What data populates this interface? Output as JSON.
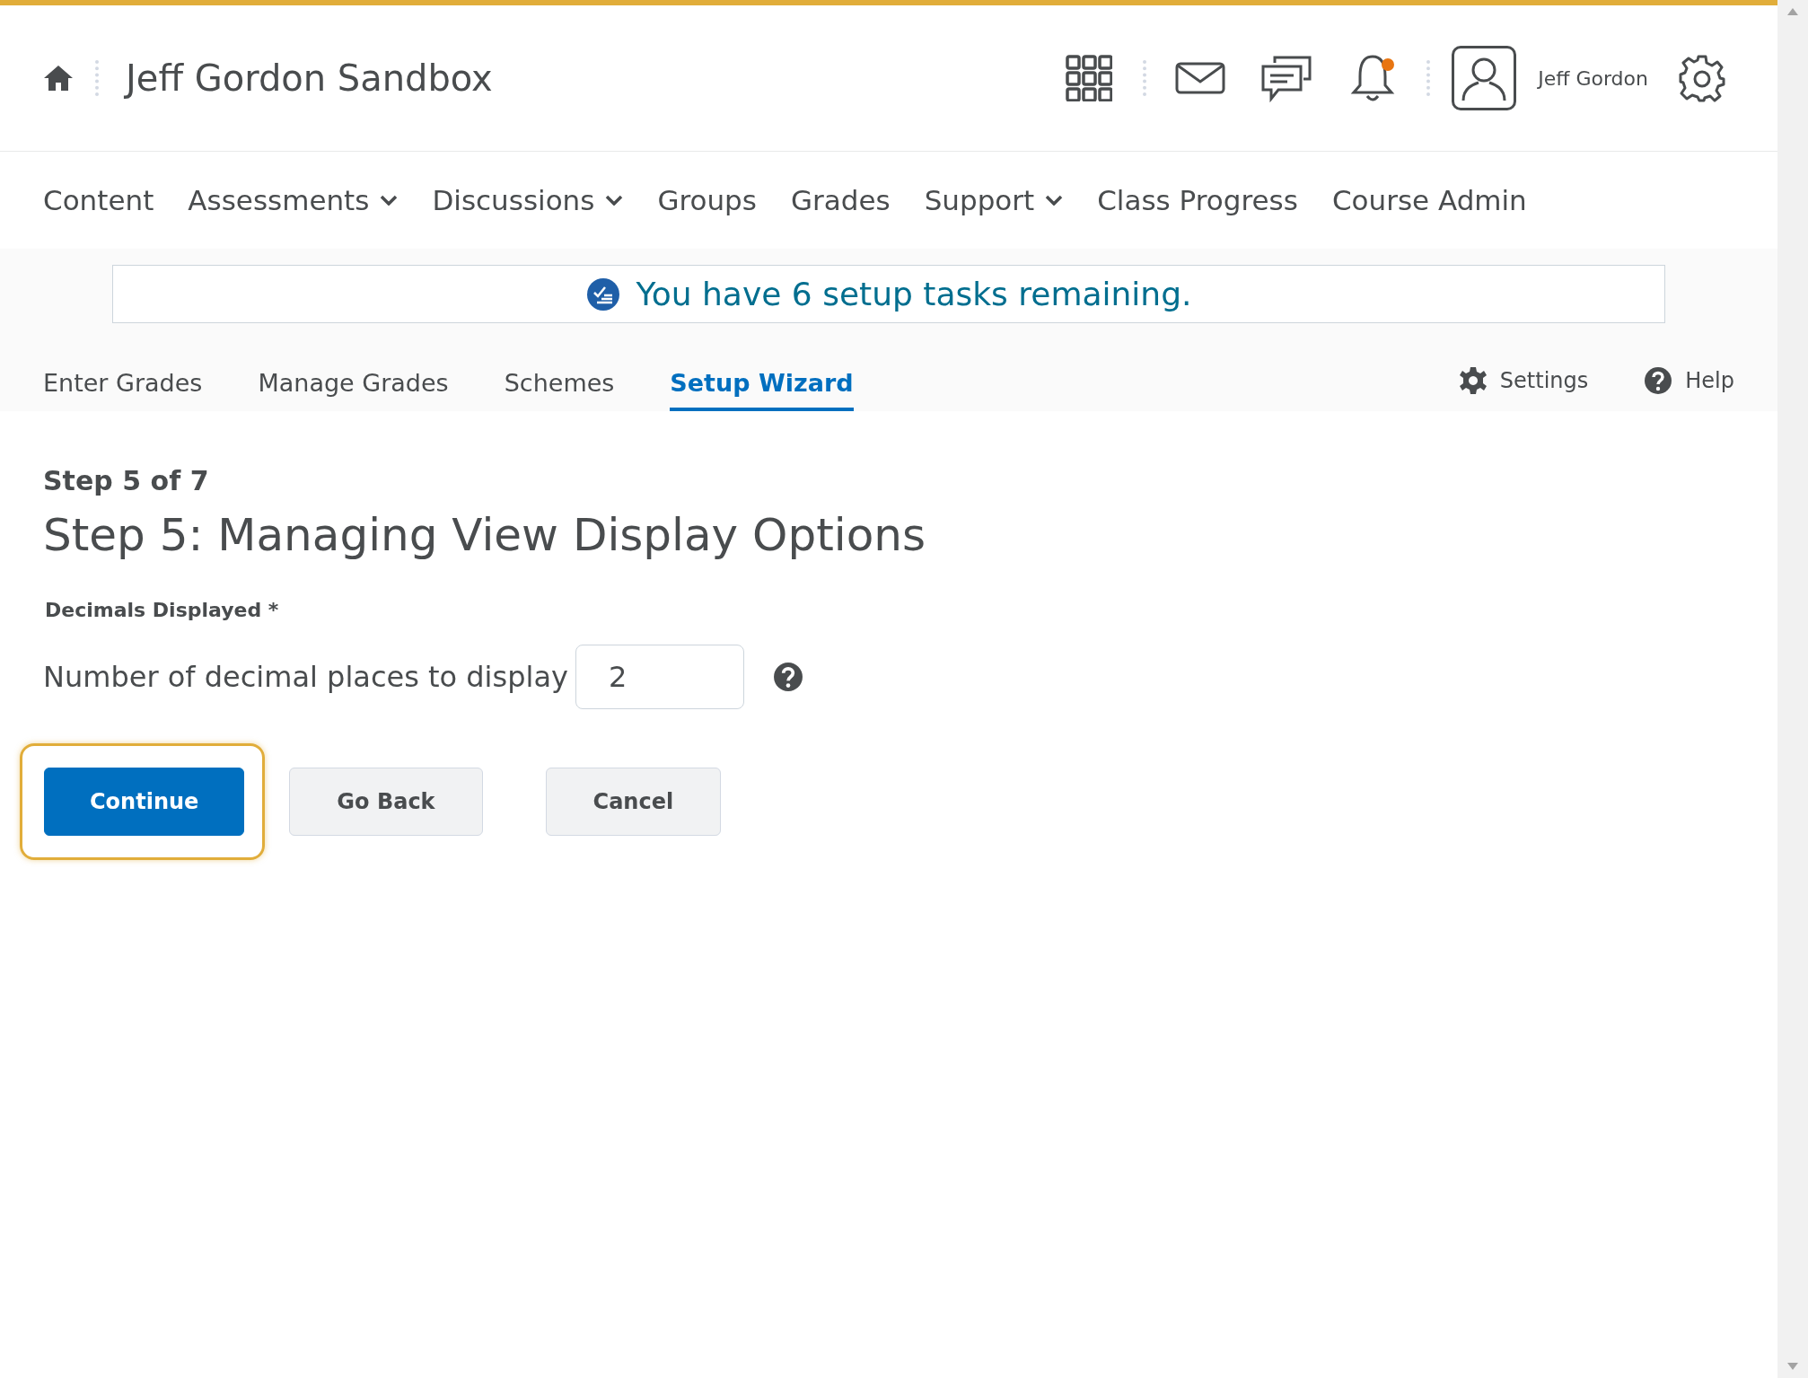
{
  "header": {
    "title": "Jeff Gordon Sandbox",
    "user_name": "Jeff Gordon",
    "notification_unread": true
  },
  "nav": [
    {
      "label": "Content",
      "dropdown": false
    },
    {
      "label": "Assessments",
      "dropdown": true
    },
    {
      "label": "Discussions",
      "dropdown": true
    },
    {
      "label": "Groups",
      "dropdown": false
    },
    {
      "label": "Grades",
      "dropdown": false
    },
    {
      "label": "Support",
      "dropdown": true
    },
    {
      "label": "Class Progress",
      "dropdown": false
    },
    {
      "label": "Course Admin",
      "dropdown": false
    }
  ],
  "banner": {
    "text": "You have 6 setup tasks remaining."
  },
  "tabs": [
    {
      "label": "Enter Grades",
      "selected": false
    },
    {
      "label": "Manage Grades",
      "selected": false
    },
    {
      "label": "Schemes",
      "selected": false
    },
    {
      "label": "Setup Wizard",
      "selected": true
    }
  ],
  "tab_actions": [
    {
      "kind": "settings",
      "label": "Settings"
    },
    {
      "kind": "help",
      "label": "Help"
    }
  ],
  "step": {
    "counter": "Step 5 of 7",
    "heading": "Step 5: Managing View Display Options"
  },
  "field": {
    "section_label": "Decimals Displayed",
    "required_mark": "*",
    "label": "Number of decimal places to display",
    "value": "2"
  },
  "buttons": [
    {
      "label": "Continue",
      "kind": "primary",
      "focused": true
    },
    {
      "label": "Go Back",
      "kind": "secondary",
      "focused": false
    },
    {
      "label": "Cancel",
      "kind": "secondary",
      "focused": false
    }
  ]
}
